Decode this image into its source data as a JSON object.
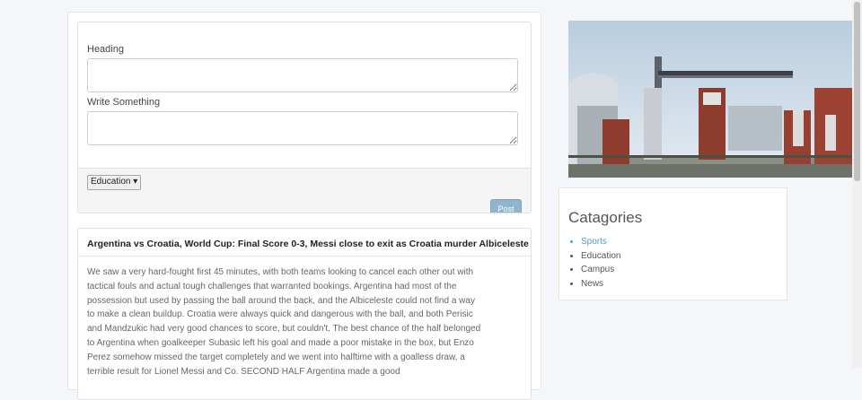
{
  "compose": {
    "heading_label": "Heading",
    "body_label": "Write Something",
    "heading_value": "",
    "body_value": "",
    "category_selected": "Education ▾",
    "post_label": "Post"
  },
  "article": {
    "title": "Argentina vs Croatia, World Cup: Final Score 0-3, Messi close to exit as Croatia murder Albiceleste",
    "body": "We saw a very hard-fought first 45 minutes, with both teams looking to cancel each other out with tactical fouls and actual tough challenges that warranted bookings. Argentina had most of the possession but used by passing the ball around the back, and the Albiceleste could not find a way to make a clean buildup. Croatia were always quick and dangerous with the ball, and both Perisic and Mandzukic had very good chances to score, but couldn't. The best chance of the half belonged to Argentina when goalkeeper Subasic left his goal and made a poor mistake in the box, but Enzo Perez somehow missed the target completely and we went into halftime with a goalless draw, a terrible result for Lionel Messi and Co. SECOND HALF Argentina made a good"
  },
  "sidebar": {
    "categories_title": "Catagories",
    "categories": [
      {
        "label": "Sports",
        "active": true
      },
      {
        "label": "Education",
        "active": false
      },
      {
        "label": "Campus",
        "active": false
      },
      {
        "label": "News",
        "active": false
      }
    ]
  },
  "colors": {
    "post_button": "#90b4ce",
    "active_link": "#5b9bc9",
    "page_bg": "#f4f6f9"
  }
}
